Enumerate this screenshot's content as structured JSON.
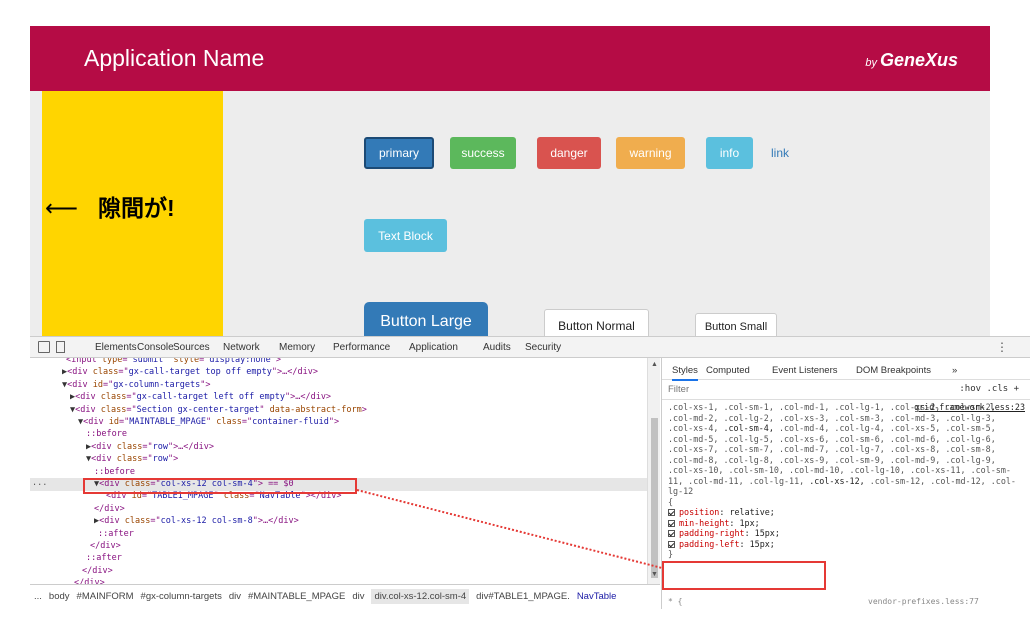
{
  "app": {
    "title": "Application Name",
    "brand_by": "by",
    "brand_name": "GeneXus",
    "gap_arrow": "⟵",
    "gap_note": "隙間が!",
    "buttons": {
      "primary": "primary",
      "success": "success",
      "danger": "danger",
      "warning": "warning",
      "info": "info",
      "link": "link",
      "text_block": "Text Block",
      "large": "Button Large",
      "normal": "Button Normal",
      "small": "Button Small"
    },
    "colors": {
      "header": "#b50c45",
      "yellow_column": "#ffd500",
      "primary": "#337ab7",
      "success": "#5cb85c",
      "danger": "#d9534f",
      "warning": "#f0ad4e",
      "info": "#5bc0de"
    }
  },
  "devtools": {
    "tabs": [
      "Elements",
      "Console",
      "Sources",
      "Network",
      "Memory",
      "Performance",
      "Application",
      "Audits",
      "Security"
    ],
    "more_icon": "vertical-dots-icon",
    "elements_dots": "...",
    "dom": [
      {
        "kind": "open",
        "tag": "input",
        "attrs": [
          [
            "type",
            "submit"
          ],
          [
            "style",
            "display:none"
          ]
        ],
        "tail": ">"
      },
      {
        "kind": "collapsed",
        "tag": "div",
        "attrs": [
          [
            "class",
            "gx-call-target top off empty"
          ]
        ],
        "tail": ">…</div>"
      },
      {
        "kind": "expanded",
        "tag": "div",
        "attrs": [
          [
            "id",
            "gx-column-targets"
          ]
        ],
        "tail": ">"
      },
      {
        "kind": "collapsed",
        "tag": "div",
        "attrs": [
          [
            "class",
            "gx-call-target left off empty"
          ]
        ],
        "tail": ">…</div>"
      },
      {
        "kind": "expanded",
        "tag": "div",
        "attrs": [
          [
            "class",
            "Section gx-center-target"
          ],
          [
            "data-abstract-form",
            ""
          ]
        ],
        "tail": ">"
      },
      {
        "kind": "expanded",
        "tag": "div",
        "attrs": [
          [
            "id",
            "MAINTABLE_MPAGE"
          ],
          [
            "class",
            "container-fluid"
          ]
        ],
        "tail": ">"
      },
      {
        "kind": "pseudo",
        "text": "::before"
      },
      {
        "kind": "collapsed",
        "tag": "div",
        "attrs": [
          [
            "class",
            "row"
          ]
        ],
        "tail": ">…</div>"
      },
      {
        "kind": "expanded",
        "tag": "div",
        "attrs": [
          [
            "class",
            "row"
          ]
        ],
        "tail": ">"
      },
      {
        "kind": "pseudo",
        "text": "::before"
      },
      {
        "kind": "expanded",
        "tag": "div",
        "attrs": [
          [
            "class",
            "col-xs-12 col-sm-4"
          ]
        ],
        "tail": "> == $0"
      },
      {
        "kind": "leaf",
        "tag": "div",
        "attrs": [
          [
            "id",
            "TABLE1_MPAGE"
          ],
          [
            "class",
            "NavTable"
          ]
        ],
        "tail": "></div>"
      },
      {
        "kind": "close",
        "text": "</div>"
      },
      {
        "kind": "collapsed",
        "tag": "div",
        "attrs": [
          [
            "class",
            "col-xs-12 col-sm-8"
          ]
        ],
        "tail": ">…</div>"
      },
      {
        "kind": "pseudo",
        "text": "::after"
      },
      {
        "kind": "close",
        "text": "</div>"
      },
      {
        "kind": "pseudo",
        "text": "::after"
      },
      {
        "kind": "close",
        "text": "</div>"
      },
      {
        "kind": "close",
        "text": "</div>"
      }
    ],
    "breadcrumbs": [
      "...",
      "body",
      "#MAINFORM",
      "#gx-column-targets",
      "div",
      "#MAINTABLE_MPAGE",
      "div",
      "div.col-xs-12.col-sm-4",
      "div#TABLE1_MPAGE.NavTable"
    ],
    "styles": {
      "tabs": [
        "Styles",
        "Computed",
        "Event Listeners",
        "DOM Breakpoints",
        "»"
      ],
      "filter_placeholder": "Filter",
      "hov_cls": ":hov  .cls  +",
      "source": "grid-framework.less:23",
      "selector": ".col-xs-1, .col-sm-1, .col-md-1, .col-lg-1, .col-xs-2, .col-sm-2, .col-md-2, .col-lg-2, .col-xs-3, .col-sm-3, .col-md-3, .col-lg-3, .col-xs-4, .col-sm-4, .col-md-4, .col-lg-4, .col-xs-5, .col-sm-5, .col-md-5, .col-lg-5, .col-xs-6, .col-sm-6, .col-md-6, .col-lg-6, .col-xs-7, .col-sm-7, .col-md-7, .col-lg-7, .col-xs-8, .col-sm-8, .col-md-8, .col-lg-8, .col-xs-9, .col-sm-9, .col-md-9, .col-lg-9, .col-xs-10, .col-sm-10, .col-md-10, .col-lg-10, .col-xs-11, .col-sm-11, .col-md-11, .col-lg-11, .col-xs-12, .col-sm-12, .col-md-12, .col-lg-12",
      "open_brace": "{",
      "declarations": [
        {
          "prop": "position",
          "value": "relative;"
        },
        {
          "prop": "min-height",
          "value": "1px;"
        },
        {
          "prop": "padding-right",
          "value": "15px;"
        },
        {
          "prop": "padding-left",
          "value": "15px;"
        }
      ],
      "close_brace": "}",
      "next_rule": "* {",
      "next_source": "vendor-prefixes.less:77"
    }
  }
}
